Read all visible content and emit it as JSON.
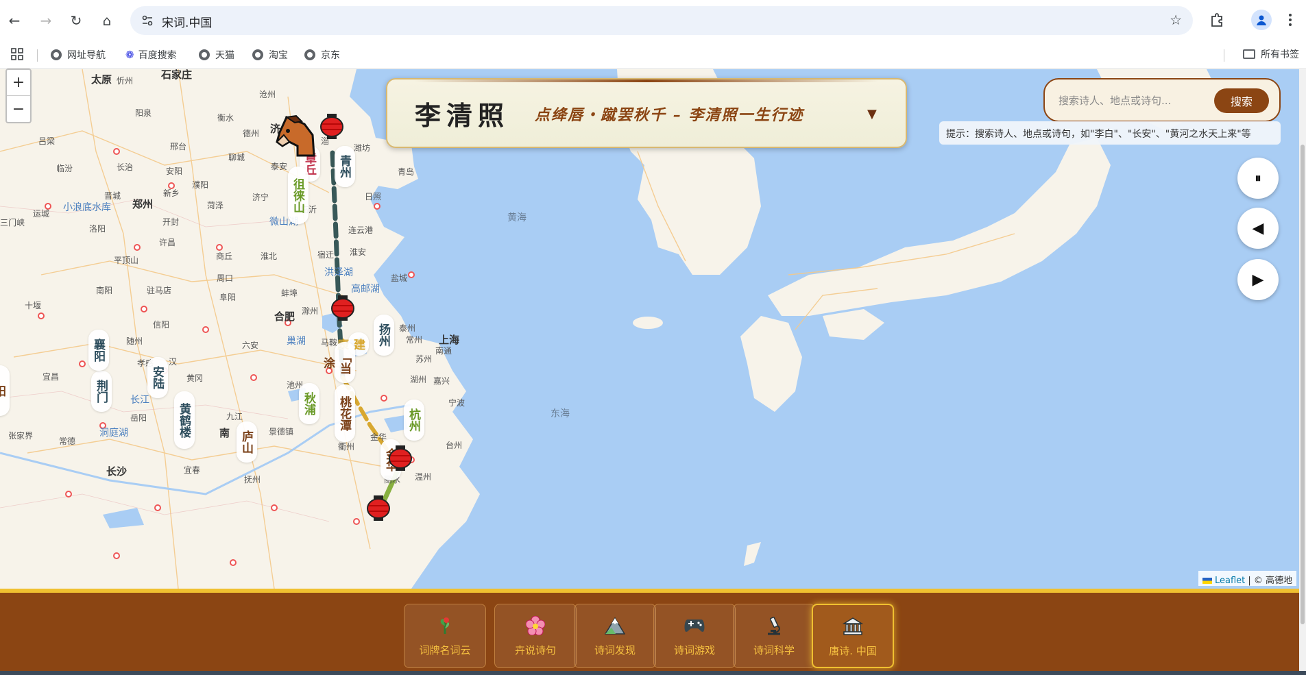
{
  "browser": {
    "url": "宋词.中国",
    "bookmarks": [
      "网址导航",
      "百度搜索",
      "天猫",
      "淘宝",
      "京东"
    ],
    "all_bookmarks": "所有书签"
  },
  "map": {
    "cities": [
      "太原",
      "忻州",
      "石家庄",
      "沧州",
      "衡水",
      "吕梁",
      "阳泉",
      "邢台",
      "德州",
      "济",
      "临汾",
      "长治",
      "安阳",
      "聊城",
      "泰安",
      "淄",
      "潍坊",
      "青岛",
      "运城",
      "晋城",
      "新乡",
      "濮阳",
      "济宁",
      "三门峡",
      "小浪底水库",
      "郑州",
      "开封",
      "菏泽",
      "日照",
      "洛阳",
      "微山湖",
      "临沂",
      "连云港",
      "平顶山",
      "许昌",
      "商丘",
      "宿迁",
      "淮安",
      "南阳",
      "驻马店",
      "周口",
      "淮北",
      "盐城",
      "十堰",
      "阜阳",
      "洪泽湖",
      "高邮湖",
      "蚌埠",
      "信阳",
      "合肥",
      "滁州",
      "泰州",
      "南通",
      "随州",
      "巢湖",
      "马鞍",
      "常州",
      "苏州",
      "上海",
      "宜昌",
      "孝感",
      "黄冈",
      "池州",
      "湖州",
      "嘉兴",
      "六安",
      "宁波",
      "岳阳",
      "九江",
      "景德镇",
      "衢州",
      "台州",
      "洞庭湖",
      "张家界",
      "常德",
      "长沙",
      "宜春",
      "丽水",
      "温州",
      "抚州",
      "南",
      "金华",
      "汉",
      "长江"
    ],
    "seas": [
      "黄海",
      "东海"
    ],
    "route_labels": [
      "章丘",
      "青州",
      "徂徕山",
      "扬州",
      "建康",
      "「当涂",
      "桃花潭",
      "秋浦",
      "杭州",
      "金华",
      "庐山",
      "黄鹤楼",
      "安陆",
      "荆门",
      "襄阳",
      "阳"
    ],
    "attribution_lib": "Leaflet",
    "attribution_src": "| © 高德地"
  },
  "zoom": {
    "in": "+",
    "out": "−"
  },
  "header": {
    "poet": "李清照",
    "subtitle": "点绛唇・蹴罢秋千 – 李清照一生行迹",
    "dropdown": "▼"
  },
  "search": {
    "placeholder": "搜索诗人、地点或诗句...",
    "button": "搜索",
    "hint": "提示：搜索诗人、地点或诗句，如\"李白\"、\"长安\"、\"黄河之水天上来\"等"
  },
  "controls": {
    "pause": "⏸",
    "prev": "◀",
    "next": "▶"
  },
  "tabs": [
    {
      "label": "词牌名词云",
      "icon": "plant-icon"
    },
    {
      "label": "卉说诗句",
      "icon": "flower-icon"
    },
    {
      "label": "诗词发现",
      "icon": "mountain-icon"
    },
    {
      "label": "诗词游戏",
      "icon": "gamepad-icon"
    },
    {
      "label": "诗词科学",
      "icon": "microscope-icon"
    },
    {
      "label": "唐诗. 中国",
      "icon": "museum-icon"
    }
  ]
}
